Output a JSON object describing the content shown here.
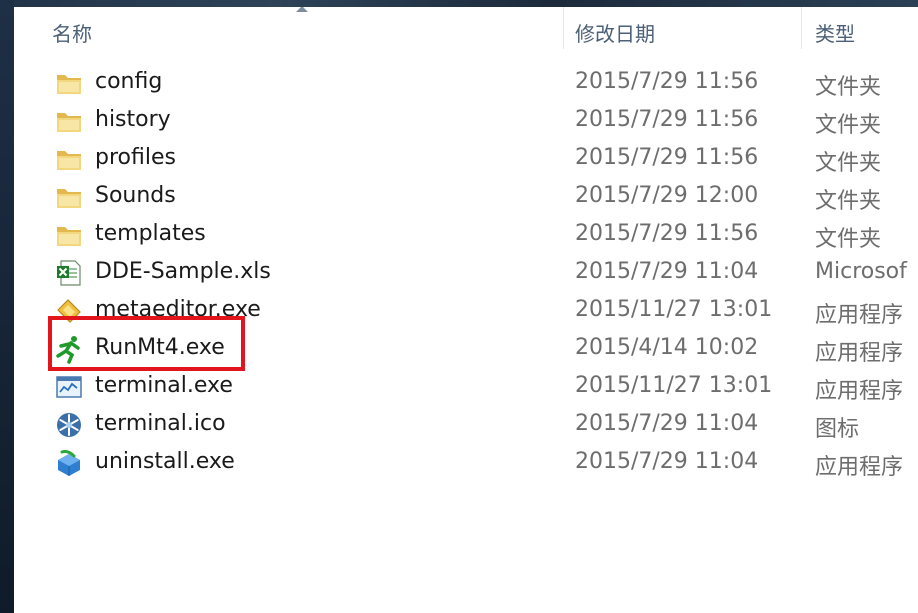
{
  "columns": {
    "name": "名称",
    "date": "修改日期",
    "type": "类型"
  },
  "files": [
    {
      "name": "config",
      "date": "2015/7/29 11:56",
      "type": "文件夹",
      "icon": "folder-icon"
    },
    {
      "name": "history",
      "date": "2015/7/29 11:56",
      "type": "文件夹",
      "icon": "folder-icon"
    },
    {
      "name": "profiles",
      "date": "2015/7/29 11:56",
      "type": "文件夹",
      "icon": "folder-icon"
    },
    {
      "name": "Sounds",
      "date": "2015/7/29 12:00",
      "type": "文件夹",
      "icon": "folder-icon"
    },
    {
      "name": "templates",
      "date": "2015/7/29 11:56",
      "type": "文件夹",
      "icon": "folder-icon"
    },
    {
      "name": "DDE-Sample.xls",
      "date": "2015/7/29 11:04",
      "type": "Microsof",
      "icon": "excel-file-icon"
    },
    {
      "name": "metaeditor.exe",
      "date": "2015/11/27 13:01",
      "type": "应用程序",
      "icon": "metaeditor-icon"
    },
    {
      "name": "RunMt4.exe",
      "date": "2015/4/14 10:02",
      "type": "应用程序",
      "icon": "running-man-icon"
    },
    {
      "name": "terminal.exe",
      "date": "2015/11/27 13:01",
      "type": "应用程序",
      "icon": "terminal-app-icon"
    },
    {
      "name": "terminal.ico",
      "date": "2015/7/29 11:04",
      "type": "图标",
      "icon": "snowflake-icon"
    },
    {
      "name": "uninstall.exe",
      "date": "2015/7/29 11:04",
      "type": "应用程序",
      "icon": "uninstall-icon"
    }
  ],
  "highlight_color": "#e3151c"
}
